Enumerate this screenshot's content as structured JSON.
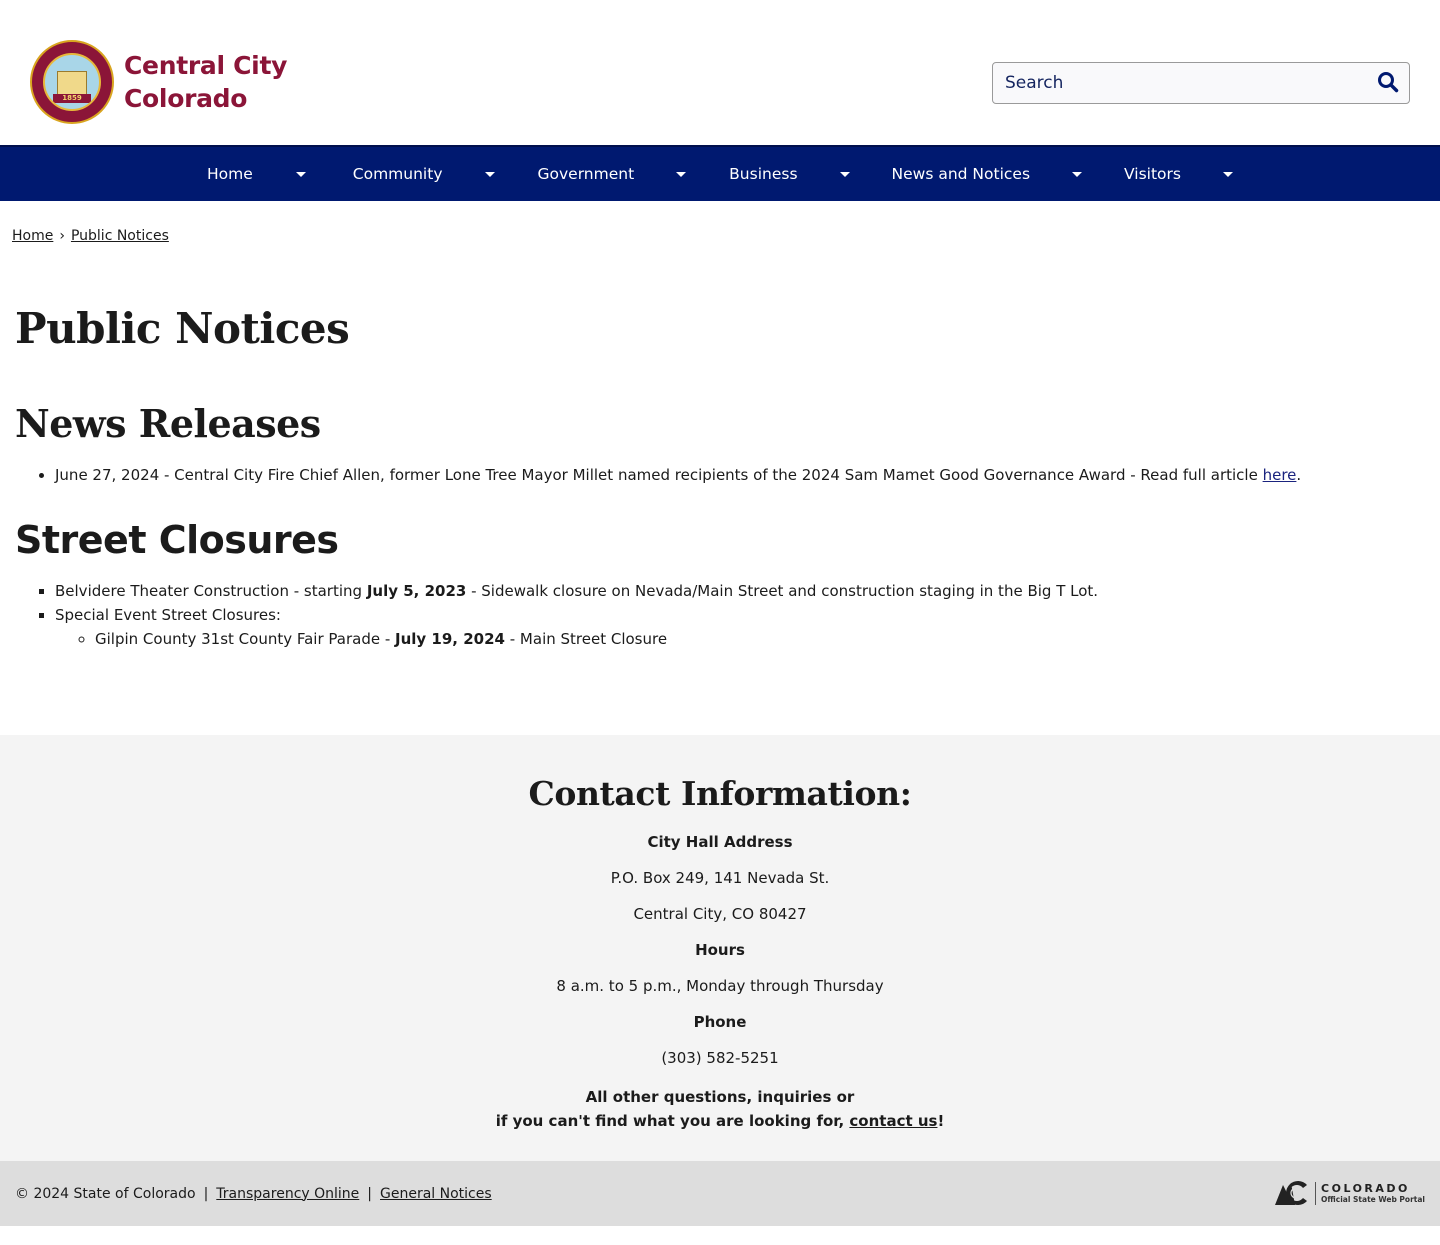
{
  "header": {
    "logo": {
      "line1": "Central City",
      "line2": "Colorado",
      "seal_year": "1859",
      "brand_color": "#8b1538"
    },
    "search": {
      "placeholder": "Search",
      "value": "",
      "icon": "search-icon"
    }
  },
  "nav": {
    "background": "#001970",
    "items": [
      {
        "label": "Home",
        "icon": "caret-down-icon"
      },
      {
        "label": "Community",
        "icon": "caret-down-icon"
      },
      {
        "label": "Government",
        "icon": "caret-down-icon"
      },
      {
        "label": "Business",
        "icon": "caret-down-icon"
      },
      {
        "label": "News and Notices",
        "icon": "caret-down-icon"
      },
      {
        "label": "Visitors",
        "icon": "caret-down-icon"
      }
    ]
  },
  "breadcrumb": {
    "items": [
      "Home",
      "Public Notices"
    ],
    "separator": "›"
  },
  "main": {
    "title": "Public Notices",
    "news": {
      "heading": "News Releases",
      "items": [
        {
          "text": "June 27, 2024 - Central City Fire Chief Allen, former Lone Tree Mayor Millet named recipients of the 2024 Sam Mamet Good Governance Award - Read full article ",
          "link_text": "here",
          "trailing": "."
        }
      ]
    },
    "closures": {
      "heading": "Street Closures",
      "items": [
        {
          "prefix": "Belvidere Theater Construction - starting ",
          "date": "July 5, 2023",
          "suffix": " - Sidewalk closure on Nevada/Main Street and construction staging in the Big T Lot."
        },
        {
          "text": "Special Event Street Closures:",
          "subitems": [
            {
              "prefix": "Gilpin County 31st County Fair Parade - ",
              "date": "July 19, 2024",
              "suffix": " - Main Street Closure"
            }
          ]
        }
      ]
    }
  },
  "contact": {
    "heading": "Contact Information:",
    "address_label": "City Hall Address",
    "address_line1": "P.O. Box 249, 141 Nevada St.",
    "address_line2": "Central City, CO 80427",
    "hours_label": "Hours",
    "hours": "8 a.m. to 5 p.m., Monday through Thursday",
    "phone_label": "Phone",
    "phone": "(303) 582-5251",
    "closing_line1": "All other questions, inquiries or",
    "closing_line2": "if you can't find what you are looking for, ",
    "closing_link": "contact us",
    "closing_end": "!"
  },
  "footer": {
    "copyright": "© 2024 State of Colorado",
    "separator": "|",
    "links": [
      "Transparency Online",
      "General Notices"
    ],
    "state_logo": {
      "title": "COLORADO",
      "subtitle": "Official State Web Portal"
    }
  }
}
